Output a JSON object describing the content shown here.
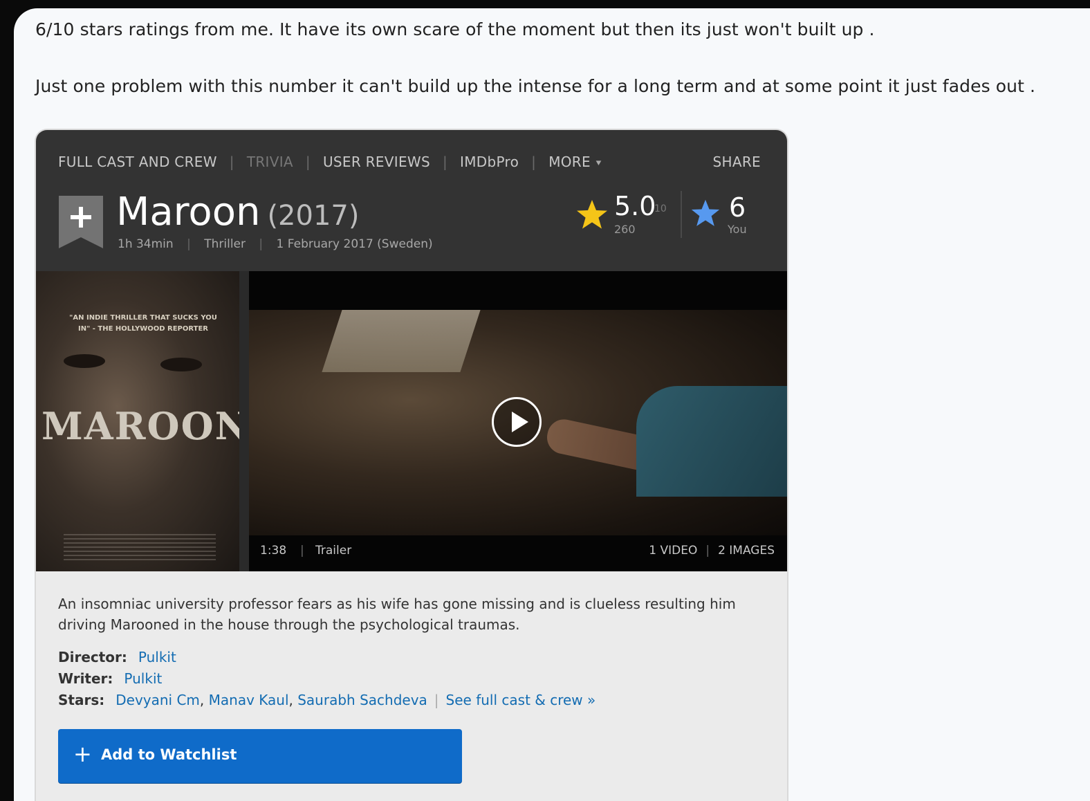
{
  "comment": {
    "line1": "6/10 stars ratings from me. It have its own scare of the moment but then its just won't built up .",
    "line2": "Just one problem with this number it can't build up the intense for a long term and at some point it just fades out ."
  },
  "nav": {
    "items": [
      "FULL CAST AND CREW",
      "TRIVIA",
      "USER REVIEWS",
      "IMDbPro",
      "MORE"
    ],
    "share": "SHARE"
  },
  "movie": {
    "title": "Maroon",
    "year": "(2017)",
    "runtime": "1h 34min",
    "genre": "Thriller",
    "release": "1 February 2017 (Sweden)",
    "rating": "5.0",
    "rating_scale": "10",
    "votes": "260",
    "your_rating": "6",
    "your_label": "You"
  },
  "poster": {
    "quote": "\"AN INDIE THRILLER THAT SUCKS YOU IN\" - THE HOLLYWOOD REPORTER",
    "title": "MAROON"
  },
  "video": {
    "duration": "1:38",
    "kind": "Trailer",
    "videos": "1 VIDEO",
    "images": "2 IMAGES"
  },
  "summary": "An insomniac university professor fears as his wife has gone missing and is clueless resulting him driving Marooned in the house through the psychological traumas.",
  "credits": {
    "director_label": "Director:",
    "director": "Pulkit",
    "writer_label": "Writer:",
    "writer": "Pulkit",
    "stars_label": "Stars:",
    "stars": [
      "Devyani Cm",
      "Manav Kaul",
      "Saurabh Sachdeva"
    ],
    "full_cast": "See full cast & crew »"
  },
  "watchlist": {
    "label": "Add to Watchlist"
  },
  "colors": {
    "accent_blue": "#0f6bc9",
    "link_blue": "#136cb2",
    "star_gold": "#f5c518",
    "star_blue": "#5799ef"
  }
}
